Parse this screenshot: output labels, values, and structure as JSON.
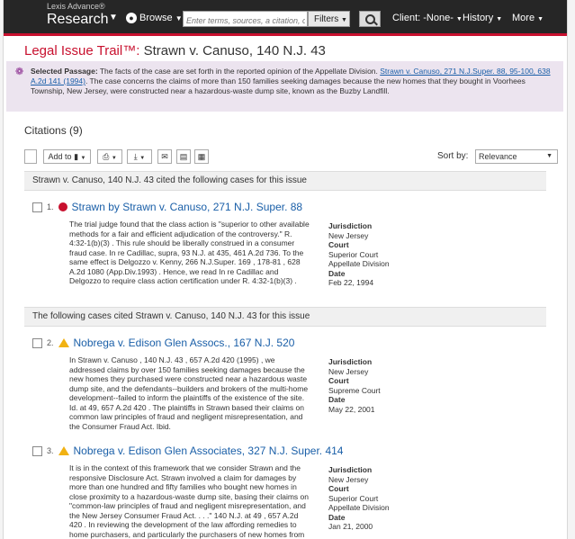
{
  "topbar": {
    "brand_top": "Lexis Advance®",
    "brand_main": "Research",
    "browse": "Browse",
    "search_placeholder": "Enter terms, sources, a citation, or shep",
    "filters": "Filters",
    "client": "Client: -None-",
    "history": "History",
    "more": "More"
  },
  "title": {
    "prefix": "Legal Issue Trail™:",
    "case": " Strawn v. Canuso, 140 N.J. 43"
  },
  "passage": {
    "label": "Selected Passage:",
    "text1": " The facts of the case are set forth in the reported opinion of the Appellate Division. ",
    "link": "Strawn v. Canuso, 271 N.J.Super. 88, 95-100, 638 A.2d 141 (1994)",
    "text2": ". The case concerns the claims of more than 150 families seeking damages because the new homes that they bought in Voorhees Township, New Jersey, were constructed near a hazardous-waste dump site, known as the Buzby Landfill."
  },
  "citations_heading": "Citations (9)",
  "toolbar": {
    "add_to": "Add to",
    "sort_by": "Sort by:",
    "sort_value": "Relevance"
  },
  "section1": "Strawn v. Canuso, 140 N.J. 43 cited the following cases for this issue",
  "section2": "The following cases cited Strawn v. Canuso, 140 N.J. 43 for this issue",
  "labels": {
    "jurisdiction": "Jurisdiction",
    "court": "Court",
    "date": "Date"
  },
  "items": [
    {
      "num": "1.",
      "title": "Strawn by Strawn v. Canuso, 271 N.J. Super. 88",
      "snippet": "The trial judge found that the class action is \"superior to other available methods for a fair and efficient adjudication of the controversy.\" R. 4:32-1(b)(3) . This rule should be liberally construed in a consumer fraud case. In re Cadillac, supra, 93 N.J. at 435, 461 A.2d 736. To the same effect is Delgozzo v. Kenny, 266 N.J.Super. 169 , 178-81 , 628 A.2d 1080 (App.Div.1993) . Hence, we read In re Cadillac and Delgozzo to require class action certification under R. 4:32-1(b)(3) .",
      "jurisdiction": "New Jersey",
      "court": "Superior Court Appellate Division",
      "date": "Feb 22, 1994"
    },
    {
      "num": "2.",
      "title": "Nobrega v. Edison Glen Assocs., 167 N.J. 520",
      "snippet": "In Strawn v. Canuso , 140 N.J. 43 , 657 A.2d 420 (1995) , we addressed claims by over 150 families seeking damages because the new homes they purchased were constructed near a hazardous waste dump site, and the defendants--builders and brokers of the multi-home development--failed to inform the plaintiffs of the existence of the site. Id. at 49, 657 A.2d 420 . The plaintiffs in Strawn based their claims on common law principles of fraud and negligent misrepresentation, and the Consumer Fraud Act. Ibid.",
      "jurisdiction": "New Jersey",
      "court": "Supreme Court",
      "date": "May 22, 2001"
    },
    {
      "num": "3.",
      "title": "Nobrega v. Edison Glen Associates, 327 N.J. Super. 414",
      "snippet": "It is in the context of this framework that we consider Strawn and the responsive Disclosure Act. Strawn involved a claim for damages by more than one hundred and fifty families who bought new homes in close proximity to a hazardous-waste dump site, basing their claims on \"common-law principles of fraud and negligent misrepresentation, and the New Jersey Consumer Fraud Act. . . .\" 140 N.J. at 49 , 657 A.2d 420 . In reviewing the development of the law affording remedies to home purchasers, and particularly the purchasers of new homes from",
      "jurisdiction": "New Jersey",
      "court": "Superior Court Appellate Division",
      "date": "Jan 21, 2000"
    }
  ]
}
